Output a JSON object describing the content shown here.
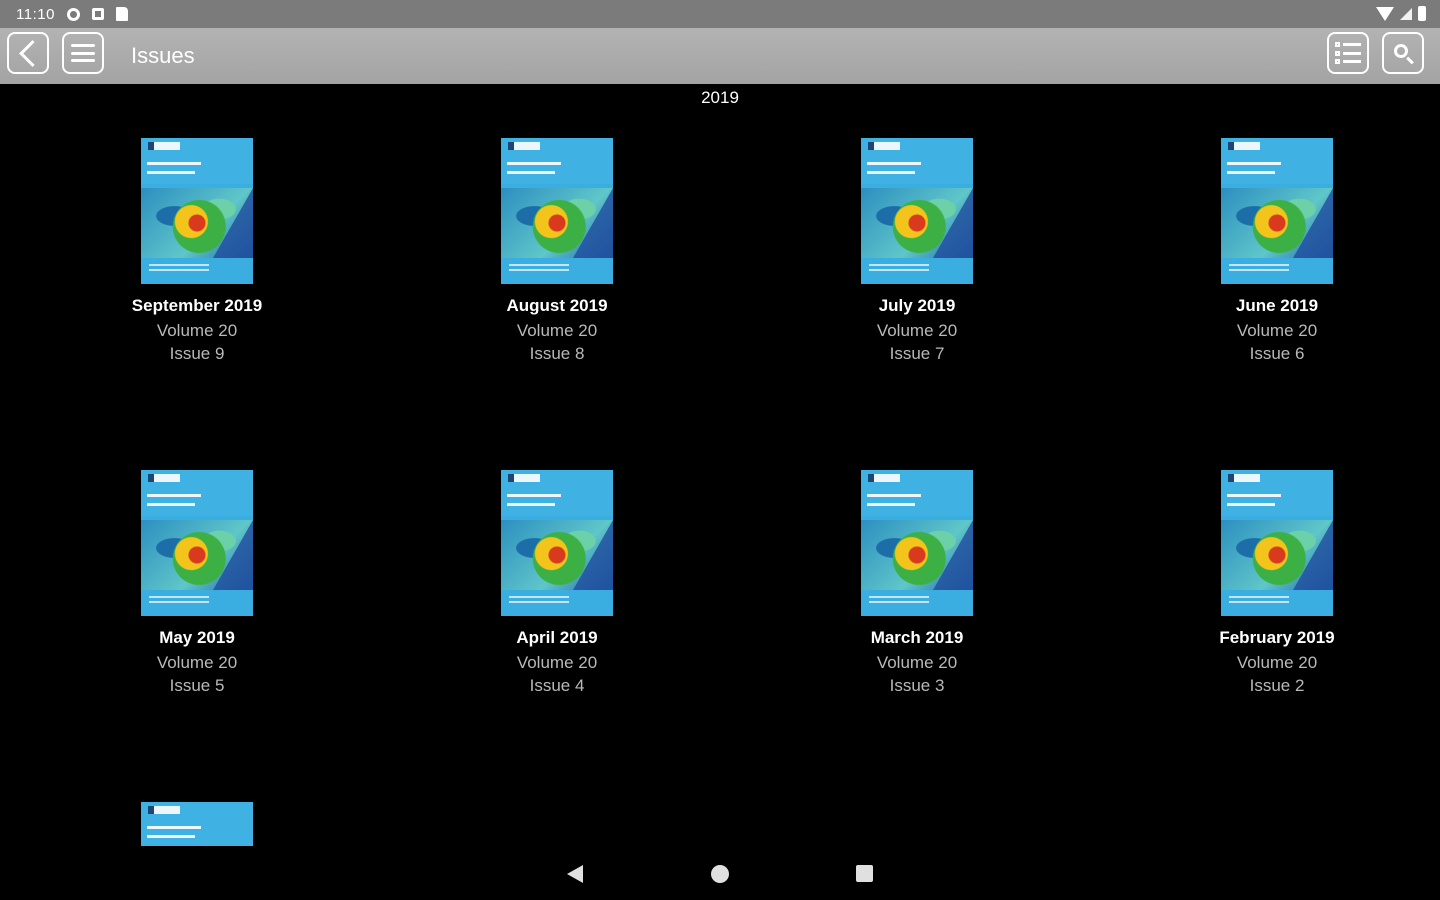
{
  "status_bar": {
    "time": "11:10",
    "icons": [
      "gear-icon",
      "square-icon",
      "sd-card-icon"
    ],
    "right_icons": [
      "wifi-icon",
      "signal-icon",
      "battery-icon"
    ]
  },
  "toolbar": {
    "title": "Issues",
    "buttons": [
      "back-icon",
      "menu-icon",
      "list-icon",
      "search-icon"
    ]
  },
  "year_header": "2019",
  "issues": [
    {
      "month": "September 2019",
      "volume": "Volume 20",
      "issue": "Issue 9"
    },
    {
      "month": "August 2019",
      "volume": "Volume 20",
      "issue": "Issue 8"
    },
    {
      "month": "July 2019",
      "volume": "Volume 20",
      "issue": "Issue 7"
    },
    {
      "month": "June 2019",
      "volume": "Volume 20",
      "issue": "Issue 6"
    },
    {
      "month": "May 2019",
      "volume": "Volume 20",
      "issue": "Issue 5"
    },
    {
      "month": "April 2019",
      "volume": "Volume 20",
      "issue": "Issue 4"
    },
    {
      "month": "March 2019",
      "volume": "Volume 20",
      "issue": "Issue 3"
    },
    {
      "month": "February 2019",
      "volume": "Volume 20",
      "issue": "Issue 2"
    }
  ],
  "nav_bar": {
    "icons": [
      "nav-back-icon",
      "nav-home-icon",
      "nav-recents-icon"
    ]
  }
}
